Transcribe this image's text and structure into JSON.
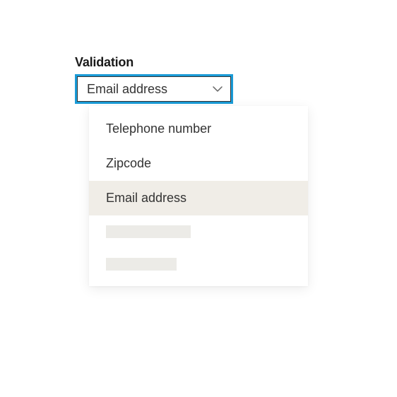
{
  "field": {
    "label": "Validation",
    "selected": "Email address"
  },
  "options": [
    {
      "label": "Telephone number",
      "highlighted": false
    },
    {
      "label": "Zipcode",
      "highlighted": false
    },
    {
      "label": "Email address",
      "highlighted": true
    }
  ]
}
